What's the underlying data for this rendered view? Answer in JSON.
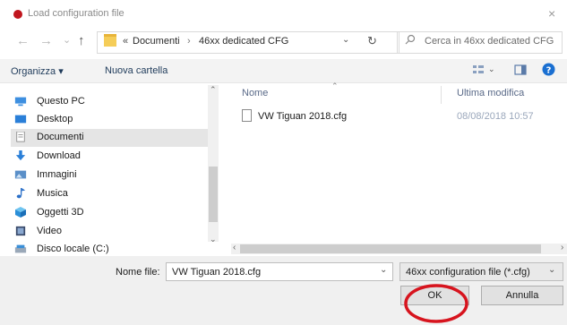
{
  "window": {
    "title": "Load configuration file",
    "close_glyph": "×"
  },
  "nav": {
    "back": "←",
    "forward": "→",
    "dropdown": "⌄",
    "up": "↑"
  },
  "address": {
    "prefix": "«",
    "crumbs": [
      "Documenti",
      "46xx dedicated CFG"
    ],
    "separator": "›",
    "refresh": "↻"
  },
  "search": {
    "placeholder": "Cerca in 46xx dedicated CFG"
  },
  "toolbar": {
    "organize": "Organizza ▾",
    "new_folder": "Nuova cartella"
  },
  "sidebar": {
    "items": [
      {
        "label": "Questo PC",
        "icon": "pc-icon"
      },
      {
        "label": "Desktop",
        "icon": "desktop-icon"
      },
      {
        "label": "Documenti",
        "icon": "documents-icon",
        "selected": true
      },
      {
        "label": "Download",
        "icon": "download-icon"
      },
      {
        "label": "Immagini",
        "icon": "images-icon"
      },
      {
        "label": "Musica",
        "icon": "music-icon"
      },
      {
        "label": "Oggetti 3D",
        "icon": "objects-3d-icon"
      },
      {
        "label": "Video",
        "icon": "video-icon"
      },
      {
        "label": "Disco locale (C:)",
        "icon": "disk-icon"
      }
    ]
  },
  "file_list": {
    "columns": {
      "name": "Nome",
      "modified": "Ultima modifica"
    },
    "rows": [
      {
        "name": "VW Tiguan 2018.cfg",
        "modified": "08/08/2018 10:57"
      }
    ]
  },
  "footer": {
    "filename_label": "Nome file:",
    "filename_value": "VW Tiguan 2018.cfg",
    "filetype": "46xx configuration file (*.cfg)",
    "ok_label": "OK",
    "cancel_label": "Annulla"
  },
  "colors": {
    "accent": "#0078d7",
    "highlight_ring": "#d7141e",
    "selected_bg": "#e5e5e5"
  }
}
